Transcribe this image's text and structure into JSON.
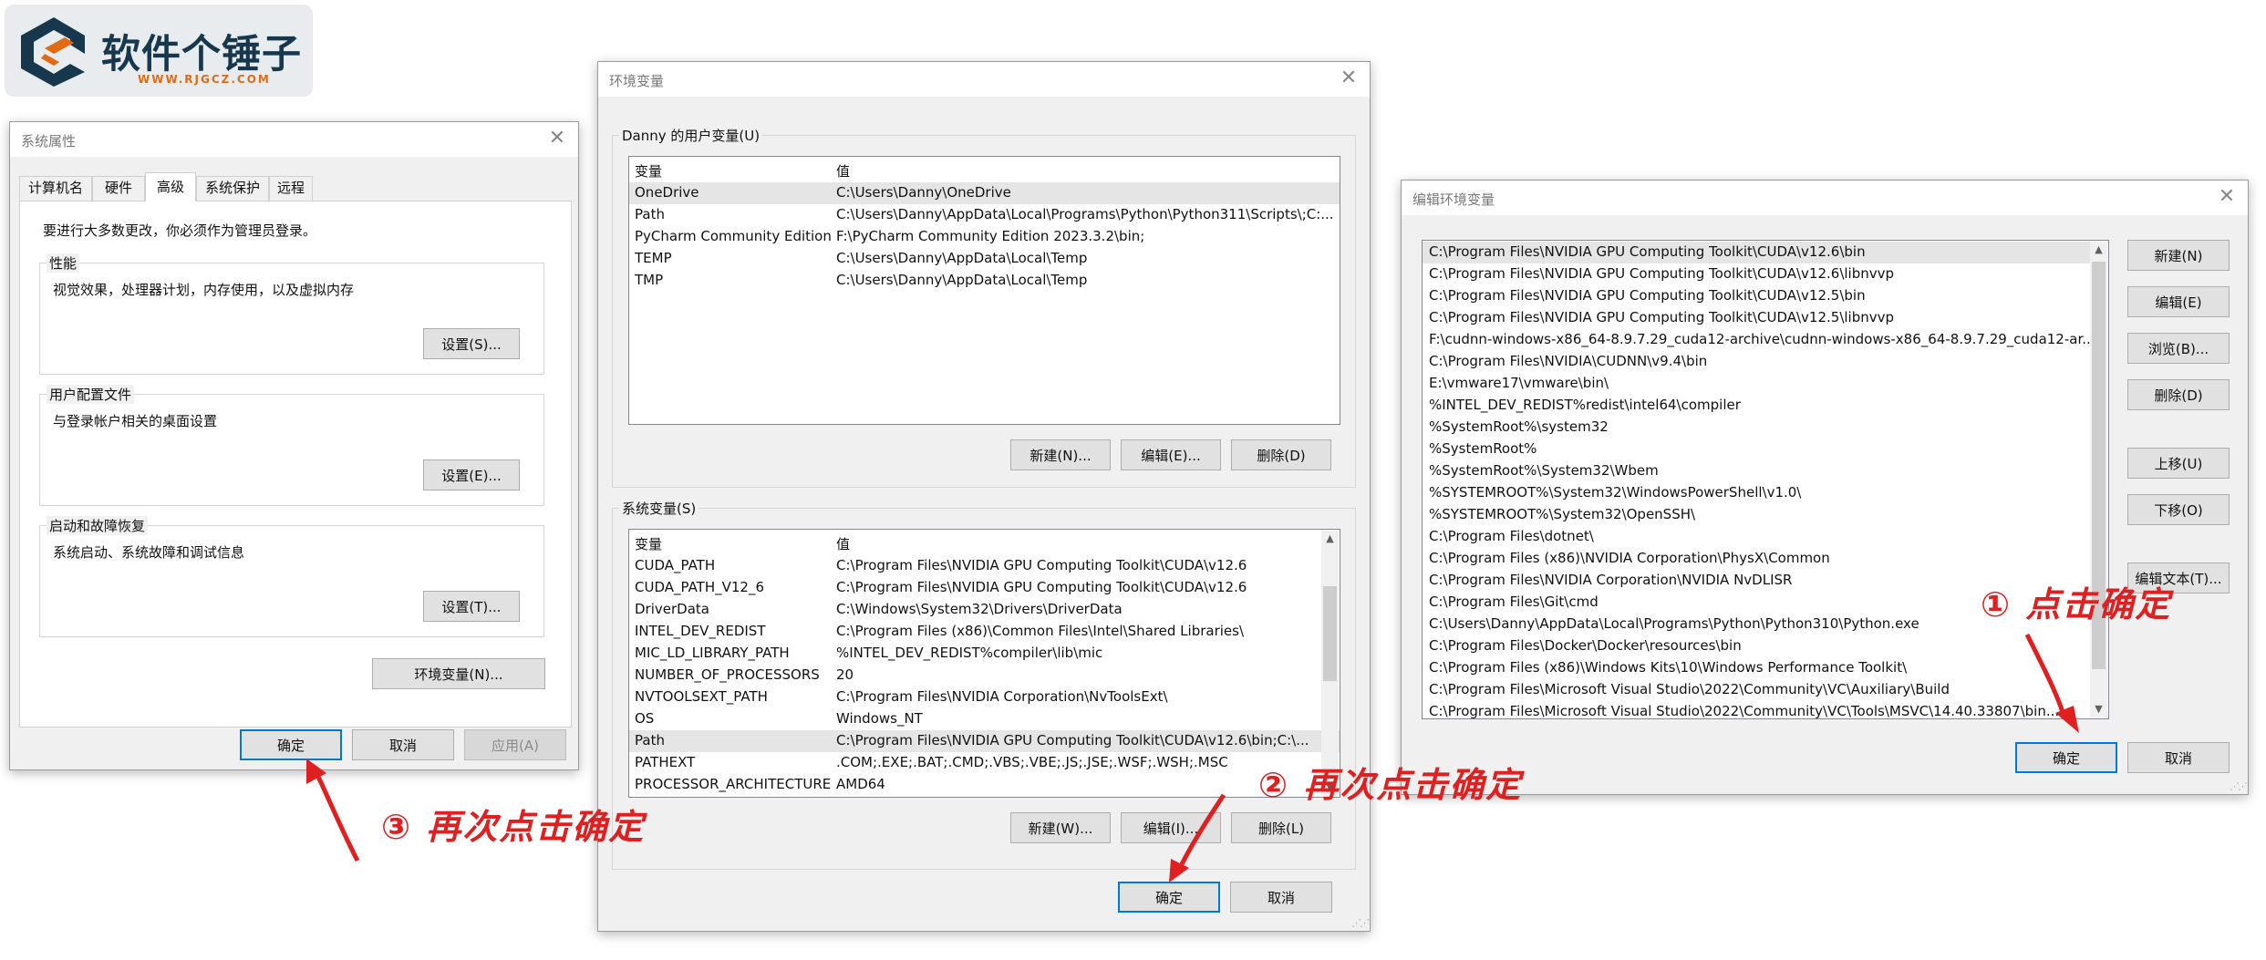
{
  "logo": {
    "title": "软件个锤子",
    "subtitle": "WWW.RJGCZ.COM"
  },
  "sysprops": {
    "title": "系统属性",
    "tabs": [
      "计算机名",
      "硬件",
      "高级",
      "系统保护",
      "远程"
    ],
    "admin_notice": "要进行大多数更改，你必须作为管理员登录。",
    "perf": {
      "title": "性能",
      "desc": "视觉效果，处理器计划，内存使用，以及虚拟内存",
      "button": "设置(S)..."
    },
    "profile": {
      "title": "用户配置文件",
      "desc": "与登录帐户相关的桌面设置",
      "button": "设置(E)..."
    },
    "startup": {
      "title": "启动和故障恢复",
      "desc": "系统启动、系统故障和调试信息",
      "button": "设置(T)..."
    },
    "env_button": "环境变量(N)...",
    "ok": "确定",
    "cancel": "取消",
    "apply": "应用(A)"
  },
  "envvars": {
    "title": "环境变量",
    "user_group": "Danny 的用户变量(U)",
    "col_var": "变量",
    "col_val": "值",
    "user_vars": [
      {
        "name": "OneDrive",
        "value": "C:\\Users\\Danny\\OneDrive"
      },
      {
        "name": "Path",
        "value": "C:\\Users\\Danny\\AppData\\Local\\Programs\\Python\\Python311\\Scripts\\;C:..."
      },
      {
        "name": "PyCharm Community Edition",
        "value": "F:\\PyCharm Community Edition 2023.3.2\\bin;"
      },
      {
        "name": "TEMP",
        "value": "C:\\Users\\Danny\\AppData\\Local\\Temp"
      },
      {
        "name": "TMP",
        "value": "C:\\Users\\Danny\\AppData\\Local\\Temp"
      }
    ],
    "user_new": "新建(N)...",
    "user_edit": "编辑(E)...",
    "user_delete": "删除(D)",
    "sys_group": "系统变量(S)",
    "sys_vars": [
      {
        "name": "CUDA_PATH",
        "value": "C:\\Program Files\\NVIDIA GPU Computing Toolkit\\CUDA\\v12.6"
      },
      {
        "name": "CUDA_PATH_V12_6",
        "value": "C:\\Program Files\\NVIDIA GPU Computing Toolkit\\CUDA\\v12.6"
      },
      {
        "name": "DriverData",
        "value": "C:\\Windows\\System32\\Drivers\\DriverData"
      },
      {
        "name": "INTEL_DEV_REDIST",
        "value": "C:\\Program Files (x86)\\Common Files\\Intel\\Shared Libraries\\"
      },
      {
        "name": "MIC_LD_LIBRARY_PATH",
        "value": "%INTEL_DEV_REDIST%compiler\\lib\\mic"
      },
      {
        "name": "NUMBER_OF_PROCESSORS",
        "value": "20"
      },
      {
        "name": "NVTOOLSEXT_PATH",
        "value": "C:\\Program Files\\NVIDIA Corporation\\NvToolsExt\\"
      },
      {
        "name": "OS",
        "value": "Windows_NT"
      },
      {
        "name": "Path",
        "value": "C:\\Program Files\\NVIDIA GPU Computing Toolkit\\CUDA\\v12.6\\bin;C:\\..."
      },
      {
        "name": "PATHEXT",
        "value": ".COM;.EXE;.BAT;.CMD;.VBS;.VBE;.JS;.JSE;.WSF;.WSH;.MSC"
      },
      {
        "name": "PROCESSOR_ARCHITECTURE",
        "value": "AMD64"
      }
    ],
    "sys_new": "新建(W)...",
    "sys_edit": "编辑(I)...",
    "sys_delete": "删除(L)",
    "ok": "确定",
    "cancel": "取消"
  },
  "editenv": {
    "title": "编辑环境变量",
    "entries": [
      "C:\\Program Files\\NVIDIA GPU Computing Toolkit\\CUDA\\v12.6\\bin",
      "C:\\Program Files\\NVIDIA GPU Computing Toolkit\\CUDA\\v12.6\\libnvvp",
      "C:\\Program Files\\NVIDIA GPU Computing Toolkit\\CUDA\\v12.5\\bin",
      "C:\\Program Files\\NVIDIA GPU Computing Toolkit\\CUDA\\v12.5\\libnvvp",
      "F:\\cudnn-windows-x86_64-8.9.7.29_cuda12-archive\\cudnn-windows-x86_64-8.9.7.29_cuda12-ar...",
      "C:\\Program Files\\NVIDIA\\CUDNN\\v9.4\\bin",
      "E:\\vmware17\\vmware\\bin\\",
      "%INTEL_DEV_REDIST%redist\\intel64\\compiler",
      "%SystemRoot%\\system32",
      "%SystemRoot%",
      "%SystemRoot%\\System32\\Wbem",
      "%SYSTEMROOT%\\System32\\WindowsPowerShell\\v1.0\\",
      "%SYSTEMROOT%\\System32\\OpenSSH\\",
      "C:\\Program Files\\dotnet\\",
      "C:\\Program Files (x86)\\NVIDIA Corporation\\PhysX\\Common",
      "C:\\Program Files\\NVIDIA Corporation\\NVIDIA NvDLISR",
      "C:\\Program Files\\Git\\cmd",
      "C:\\Users\\Danny\\AppData\\Local\\Programs\\Python\\Python310\\Python.exe",
      "C:\\Program Files\\Docker\\Docker\\resources\\bin",
      "C:\\Program Files (x86)\\Windows Kits\\10\\Windows Performance Toolkit\\",
      "C:\\Program Files\\Microsoft Visual Studio\\2022\\Community\\VC\\Auxiliary\\Build",
      "C:\\Program Files\\Microsoft Visual Studio\\2022\\Community\\VC\\Tools\\MSVC\\14.40.33807\\bin..."
    ],
    "btn_new": "新建(N)",
    "btn_edit": "编辑(E)",
    "btn_browse": "浏览(B)...",
    "btn_delete": "删除(D)",
    "btn_up": "上移(U)",
    "btn_down": "下移(O)",
    "btn_edit_text": "编辑文本(T)...",
    "ok": "确定",
    "cancel": "取消"
  },
  "annotations": {
    "step1": "① 点击确定",
    "step2": "② 再次点击确定",
    "step3": "③ 再次点击确定"
  },
  "colors": {
    "annotation": "#e02020",
    "focus_border": "#0078d7",
    "logo_accent": "#e06b14",
    "logo_text": "#17384c"
  }
}
